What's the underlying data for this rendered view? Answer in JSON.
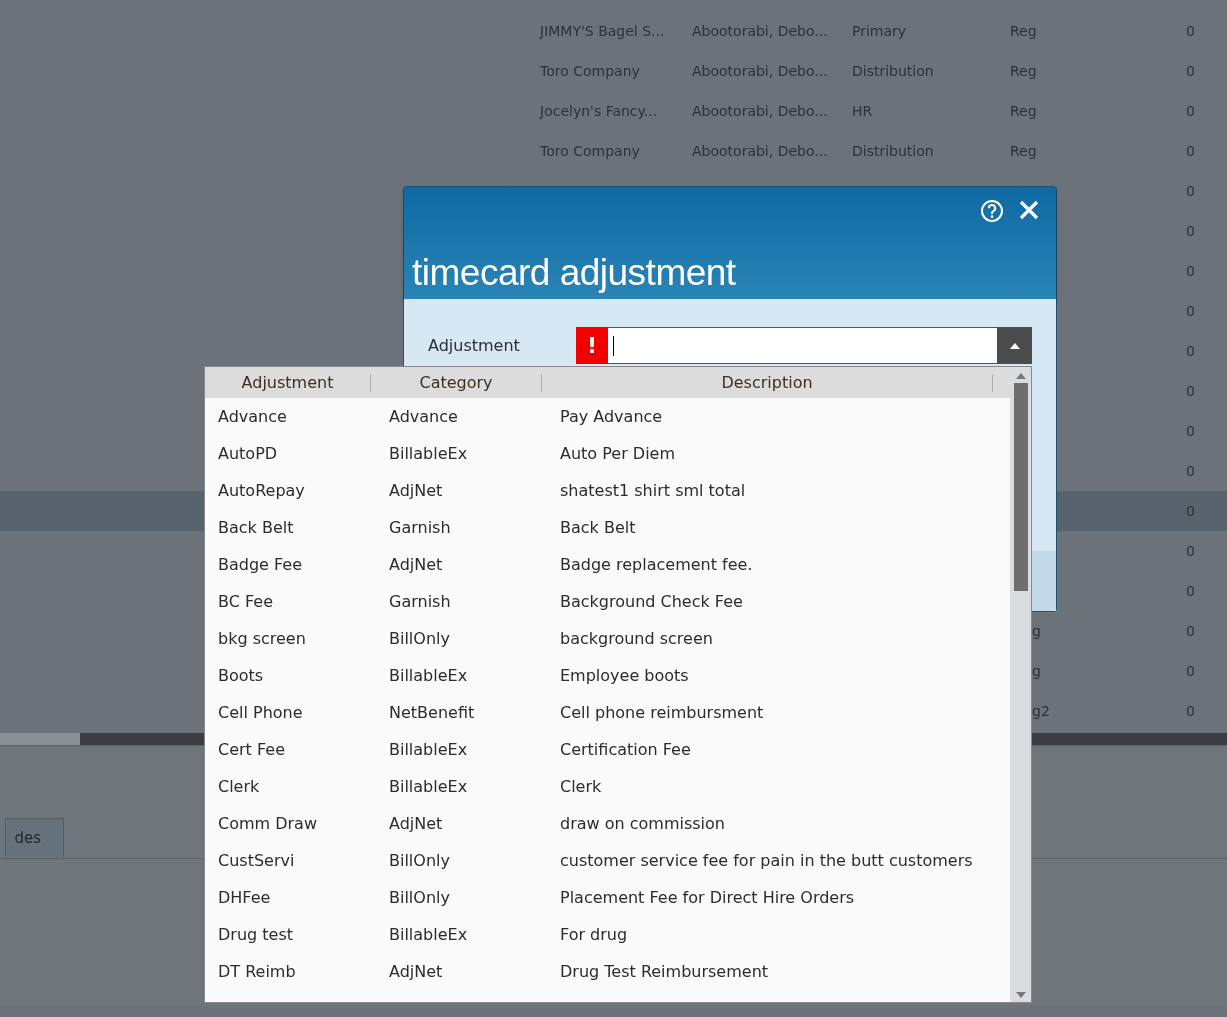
{
  "background_table": {
    "rows": [
      {
        "company": "JIMMY'S Bagel S...",
        "employee": "Abootorabi, Debo...",
        "department": "Primary",
        "pay_type": "Reg",
        "value": "0",
        "highlighted": false,
        "kind": "full"
      },
      {
        "company": "Toro Company",
        "employee": "Abootorabi, Debo...",
        "department": "Distribution",
        "pay_type": "Reg",
        "value": "0",
        "highlighted": false,
        "kind": "full"
      },
      {
        "company": "Jocelyn's Fancy...",
        "employee": "Abootorabi, Debo...",
        "department": "HR",
        "pay_type": "Reg",
        "value": "0",
        "highlighted": false,
        "kind": "full"
      },
      {
        "company": "Toro Company",
        "employee": "Abootorabi, Debo...",
        "department": "Distribution",
        "pay_type": "Reg",
        "value": "0",
        "highlighted": false,
        "kind": "full"
      },
      {
        "value": "0",
        "highlighted": false,
        "kind": "covered"
      },
      {
        "value": "0",
        "highlighted": false,
        "kind": "covered"
      },
      {
        "value": "0",
        "highlighted": false,
        "kind": "covered"
      },
      {
        "value": "0",
        "highlighted": false,
        "kind": "covered"
      },
      {
        "value": "0",
        "highlighted": false,
        "kind": "covered"
      },
      {
        "value": "0",
        "highlighted": false,
        "kind": "covered"
      },
      {
        "value": "0",
        "highlighted": false,
        "kind": "covered"
      },
      {
        "value": "0",
        "highlighted": false,
        "kind": "covered"
      },
      {
        "value": "0",
        "highlighted": true,
        "kind": "covered"
      },
      {
        "value": "0",
        "highlighted": false,
        "kind": "covered"
      },
      {
        "value": "0",
        "highlighted": false,
        "kind": "covered"
      },
      {
        "pay_type": "g",
        "value": "0",
        "highlighted": false,
        "kind": "partial"
      },
      {
        "pay_type": "g",
        "value": "0",
        "highlighted": false,
        "kind": "partial"
      },
      {
        "pay_type": "g2",
        "value": "0",
        "highlighted": false,
        "kind": "partial"
      }
    ]
  },
  "bottom_tab": {
    "label": "des"
  },
  "dialog": {
    "title": "timecard adjustment",
    "field": {
      "label": "Adjustment",
      "invalid": true,
      "error_mark": "!",
      "expanded": true
    },
    "dropdown": {
      "columns": [
        "Adjustment",
        "Category",
        "Description"
      ],
      "rows": [
        {
          "adjustment": "Advance",
          "category": "Advance",
          "description": "Pay Advance"
        },
        {
          "adjustment": "AutoPD",
          "category": "BillableEx",
          "description": "Auto Per Diem"
        },
        {
          "adjustment": "AutoRepay",
          "category": "AdjNet",
          "description": "shatest1 shirt sml total"
        },
        {
          "adjustment": "Back Belt",
          "category": "Garnish",
          "description": "Back Belt"
        },
        {
          "adjustment": "Badge Fee",
          "category": "AdjNet",
          "description": "Badge replacement fee."
        },
        {
          "adjustment": "BC Fee",
          "category": "Garnish",
          "description": "Background Check Fee"
        },
        {
          "adjustment": "bkg screen",
          "category": "BillOnly",
          "description": "background screen"
        },
        {
          "adjustment": "Boots",
          "category": "BillableEx",
          "description": "Employee boots"
        },
        {
          "adjustment": "Cell Phone",
          "category": "NetBenefit",
          "description": "Cell phone reimbursment"
        },
        {
          "adjustment": "Cert Fee",
          "category": "BillableEx",
          "description": "Certification Fee"
        },
        {
          "adjustment": "Clerk",
          "category": "BillableEx",
          "description": "Clerk"
        },
        {
          "adjustment": "Comm Draw",
          "category": "AdjNet",
          "description": "draw on commission"
        },
        {
          "adjustment": "CustServi",
          "category": "BillOnly",
          "description": "customer service fee for pain in the butt customers"
        },
        {
          "adjustment": "DHFee",
          "category": "BillOnly",
          "description": "Placement Fee for Direct Hire Orders"
        },
        {
          "adjustment": "Drug test",
          "category": "BillableEx",
          "description": "For drug"
        },
        {
          "adjustment": "DT Reimb",
          "category": "AdjNet",
          "description": "Drug Test Reimbursement"
        }
      ]
    }
  }
}
